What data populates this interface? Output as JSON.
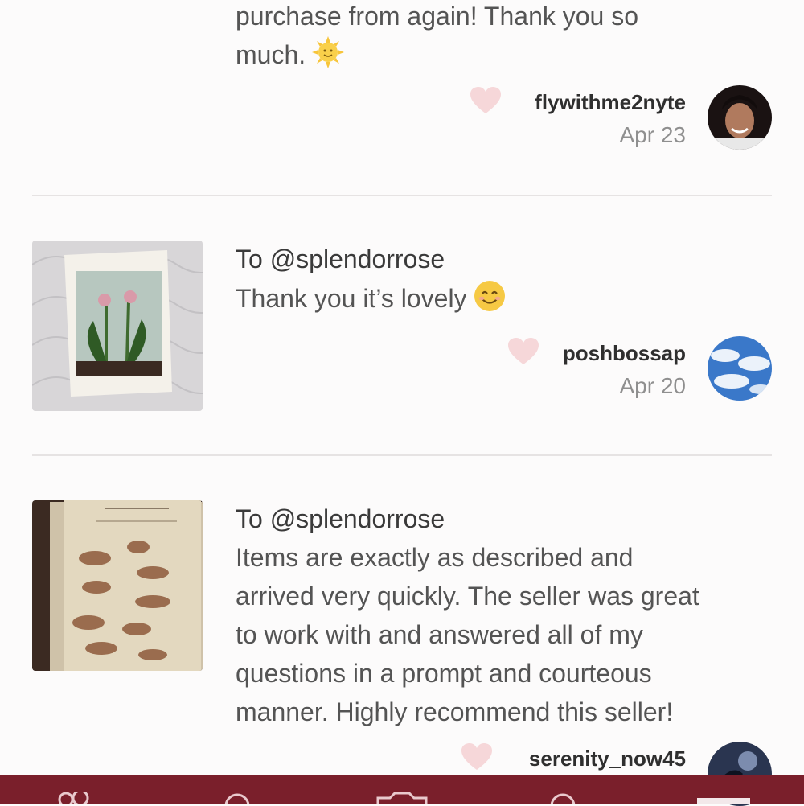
{
  "reviews": [
    {
      "to": "",
      "text_lines": [
        "purchase from again! Thank you so",
        "much."
      ],
      "emoji": "sun-emoji",
      "username": "flywithme2nyte",
      "date": "Apr 23",
      "avatar": "woman-portrait"
    },
    {
      "to": "To @splendorrose",
      "text": "Thank you it’s lovely",
      "emoji": "smiling-face-emoji",
      "username": "poshbossap",
      "date": "Apr 20",
      "avatar": "blue-sky-clouds",
      "thumbnail": "botanical-flower-print"
    },
    {
      "to": "To @splendorrose",
      "text_lines": [
        "Items are exactly as described and",
        "arrived very quickly. The seller was great",
        "to work with and answered all of my",
        "questions in a prompt and courteous",
        "manner. Highly recommend this seller!"
      ],
      "username": "serenity_now45",
      "avatar": "night-sky",
      "thumbnail": "vintage-bird-print"
    }
  ],
  "colors": {
    "background": "#fcfbfb",
    "heart": "#f6d7d9",
    "bottom_bar": "#7a1f2b",
    "divider": "#e6e3e3"
  },
  "bottom_nav": {
    "icons": [
      "community-icon",
      "search-icon",
      "camera-icon",
      "news-icon",
      "account-icon"
    ]
  }
}
